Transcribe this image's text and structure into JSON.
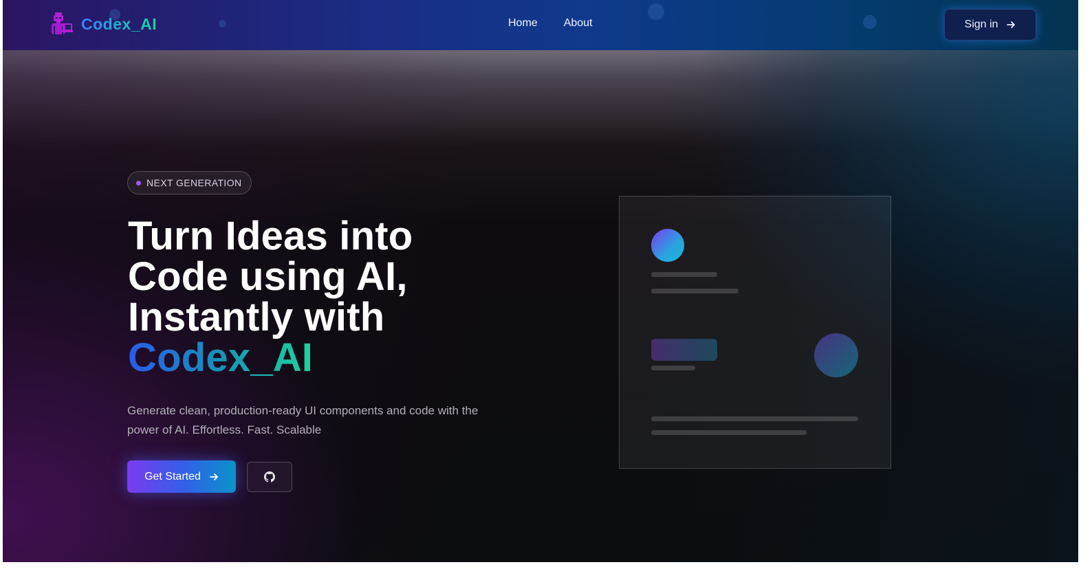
{
  "nav": {
    "brand": "Codex_AI",
    "links": [
      "Home",
      "About"
    ],
    "signin_label": "Sign in"
  },
  "hero": {
    "badge": "NEXT GENERATION",
    "headline_lines": [
      "Turn Ideas into",
      "Code using AI,",
      "Instantly with"
    ],
    "headline_brand": "Codex_AI",
    "subtext": "Generate clean, production-ready UI components and code with the power of AI. Effortless. Fast. Scalable",
    "cta_label": "Get Started"
  },
  "colors": {
    "accent_purple": "#7b3bf0",
    "accent_teal": "#1dd1a1",
    "accent_blue": "#2f63e6",
    "nav_dark": "#1a2d86"
  },
  "icons": {
    "logo": "developer-robot-icon",
    "signin": "arrow-right-icon",
    "cta": "arrow-right-icon",
    "secondary": "github-icon"
  }
}
